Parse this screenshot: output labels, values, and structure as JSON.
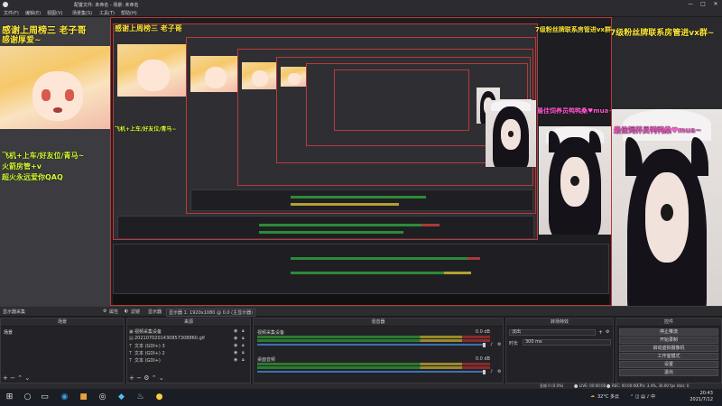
{
  "window": {
    "title": "配置文件: 未命名 - 场景: 未命名",
    "controls": [
      "—",
      "□",
      "✕"
    ]
  },
  "menubar": [
    "文件(F)",
    "编辑(E)",
    "视图(V)",
    "场景集(S)",
    "工具(T)",
    "帮助(H)"
  ],
  "overlays": {
    "thanks_left": "感谢上周榜三 老子哥",
    "thanks_left2": "感谢厚爱~",
    "right_line1": "7级粉丝牌联系房管进vx群~",
    "pink_left": "最佳饲养员鸭鸭桑♥mua~",
    "pink_right": "最佳饲养员鸭鸭桑♥mua~",
    "promo_1": "飞机+上车/好友位/青马~",
    "promo_2": "火箭房管+v",
    "promo_3": "超火永远爱你QAQ"
  },
  "dockbar": {
    "label": "显示器采集",
    "props_icon": "gear-icon",
    "props": "属性",
    "filters_icon": "filter-icon",
    "filters": "滤镜",
    "display_label": "显示器",
    "display_value": "显示器 1: 1920x1080 @ 0,0 (主显示器)"
  },
  "scenes": {
    "title": "场景",
    "items": [
      "场景"
    ]
  },
  "sources": {
    "title": "来源",
    "items": [
      {
        "icon": "image-icon",
        "name": "视频采集设备"
      },
      {
        "icon": "gif-icon",
        "name": "2021070201430857308860.gif"
      },
      {
        "icon": "text-icon",
        "name": "文本 (GDI+) 3"
      },
      {
        "icon": "text-icon",
        "name": "文本 (GDI+) 2"
      },
      {
        "icon": "text-icon",
        "name": "文本 (GDI+)"
      }
    ]
  },
  "mixer": {
    "title": "混音器",
    "channels": [
      {
        "name": "视频采集设备",
        "db": "0.0 dB"
      },
      {
        "name": "桌面音频",
        "db": "0.0 dB"
      }
    ]
  },
  "transitions": {
    "title": "转场特效",
    "selected": "淡出",
    "duration_label": "时长",
    "duration_value": "300 ms"
  },
  "controls": {
    "title": "控件",
    "buttons": [
      "停止推流",
      "开始录制",
      "启动虚拟摄像机",
      "工作室模式",
      "设置",
      "退出"
    ]
  },
  "status": {
    "dropped": "丢帧 0 (0.0%)",
    "live": "LIVE: 00:00:00",
    "rec": "REC: 00:00:00",
    "cpu": "CPU: 3.4%, 30.00 fps",
    "kbps": "kb/s: 0"
  },
  "taskbar": {
    "weather": "32°C 多云",
    "time": "20:43",
    "date": "2021/7/12"
  },
  "colors": {
    "accent_red": "#b83a3a",
    "overlay_yellow": "#ffe93a",
    "overlay_pink": "#ff5ad0",
    "meter_green": "#2b7a2f",
    "slider_blue": "#3d6fb5"
  }
}
